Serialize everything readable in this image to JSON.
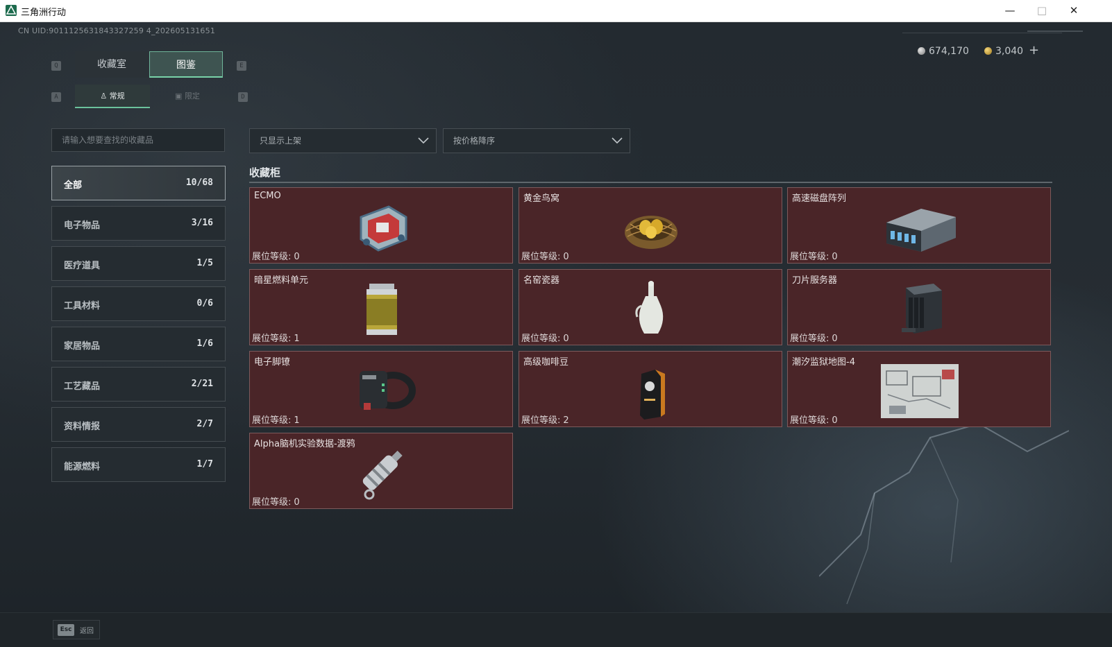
{
  "window": {
    "title": "三角洲行动",
    "minimize": "—",
    "maximize": "□",
    "close": "✕"
  },
  "uid": "CN UID:9011125631843327259 4_202605131651",
  "currency": {
    "silver": "674,170",
    "gold": "3,040",
    "add": "+"
  },
  "keys": {
    "q": "Q",
    "e": "E",
    "a": "A",
    "d": "D"
  },
  "tabs": {
    "main": [
      "收藏室",
      "图鉴"
    ],
    "sub": [
      "常规",
      "限定"
    ]
  },
  "search": {
    "placeholder": "请输入想要查找的收藏品"
  },
  "filters": {
    "shelf": "只显示上架",
    "sort": "按价格降序"
  },
  "categories": [
    {
      "label": "全部",
      "count": "10/68"
    },
    {
      "label": "电子物品",
      "count": "3/16"
    },
    {
      "label": "医疗道具",
      "count": "1/5"
    },
    {
      "label": "工具材料",
      "count": "0/6"
    },
    {
      "label": "家居物品",
      "count": "1/6"
    },
    {
      "label": "工艺藏品",
      "count": "2/21"
    },
    {
      "label": "资料情报",
      "count": "2/7"
    },
    {
      "label": "能源燃料",
      "count": "1/7"
    }
  ],
  "section": {
    "title": "收藏柜"
  },
  "level_label": "展位等级:",
  "items": [
    {
      "name": "ECMO",
      "level": "0",
      "icon": "ecmo-machine-icon"
    },
    {
      "name": "黄金鸟窝",
      "level": "0",
      "icon": "golden-nest-icon"
    },
    {
      "name": "高速磁盘阵列",
      "level": "0",
      "icon": "disk-array-icon"
    },
    {
      "name": "暗星燃料单元",
      "level": "1",
      "icon": "fuel-cell-icon"
    },
    {
      "name": "名窑瓷器",
      "level": "0",
      "icon": "porcelain-vase-icon"
    },
    {
      "name": "刀片服务器",
      "level": "0",
      "icon": "blade-server-icon"
    },
    {
      "name": "电子脚镣",
      "level": "1",
      "icon": "electronic-shackle-icon"
    },
    {
      "name": "高级咖啡豆",
      "level": "2",
      "icon": "coffee-beans-icon"
    },
    {
      "name": "潮汐监狱地图-4",
      "level": "0",
      "icon": "prison-map-icon"
    },
    {
      "name": "Alpha脑机实验数据-渡鸦",
      "level": "0",
      "icon": "data-capsule-icon"
    }
  ],
  "footer": {
    "esc_key": "Esc",
    "back": "返回"
  },
  "colors": {
    "card_bg": "#4a2528",
    "accent_green": "#79d3a9"
  }
}
